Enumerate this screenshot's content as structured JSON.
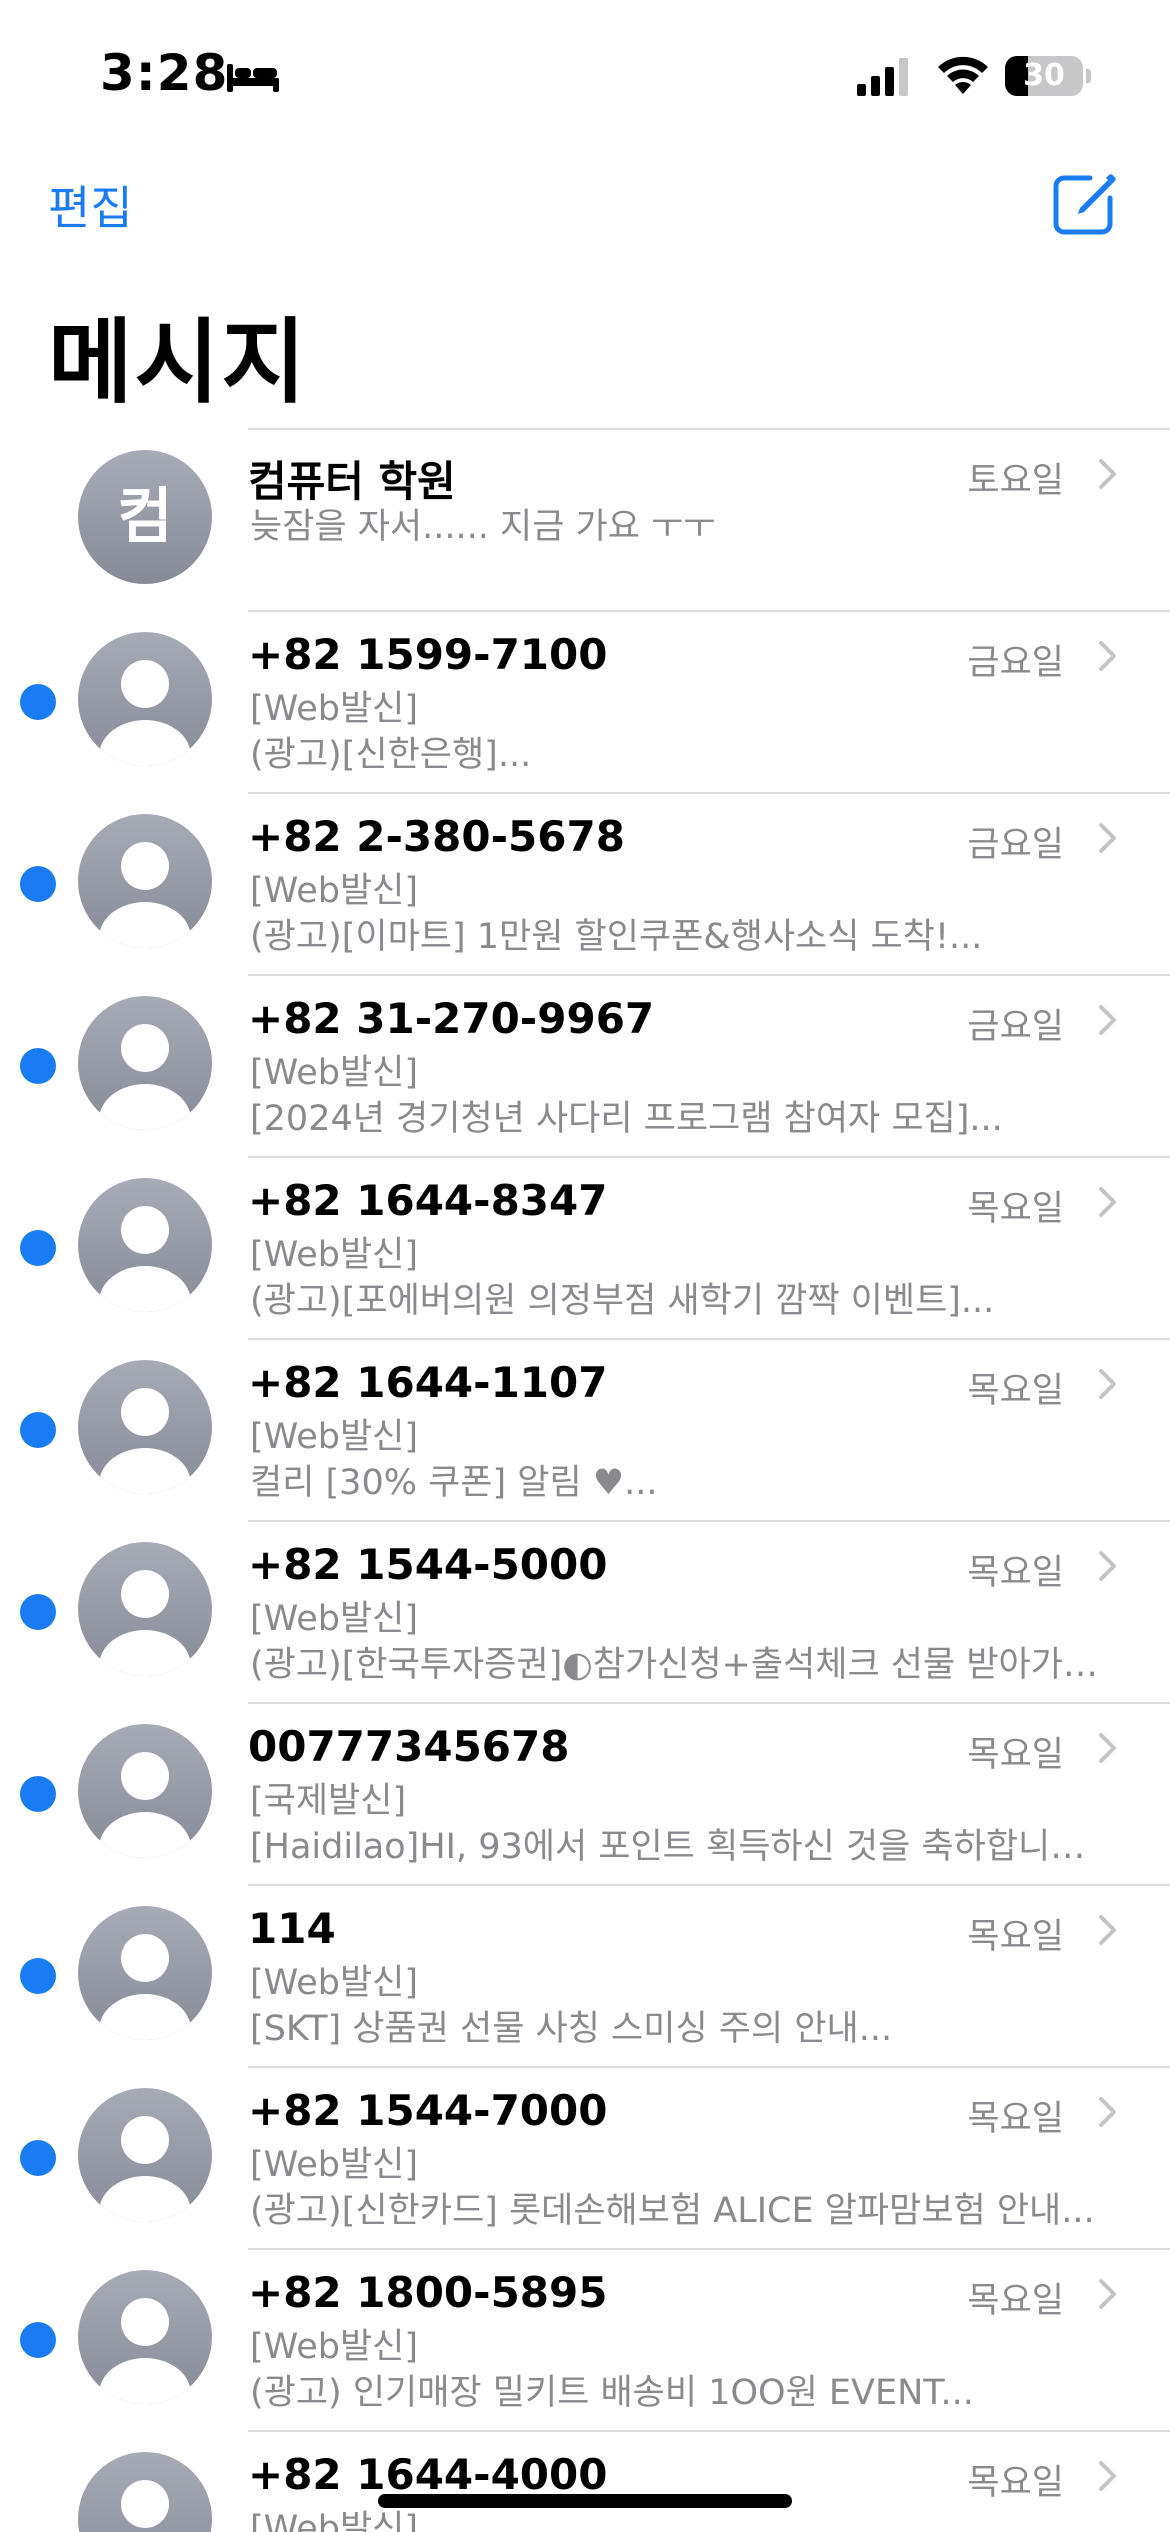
{
  "status_bar": {
    "time": "3:28",
    "battery": "30",
    "battery_level_percent": 30
  },
  "nav": {
    "edit_label": "편집",
    "title": "메시지"
  },
  "conversations": [
    {
      "sender": "컴퓨터 학원",
      "day": "토요일",
      "preview1": "늦잠을 자서...... 지금 가요 ㅜㅜ",
      "preview2": "",
      "unread": false,
      "initial": "컴"
    },
    {
      "sender": "+82 1599-7100",
      "day": "금요일",
      "preview1": "[Web발신]",
      "preview2": "(광고)[신한은행]...",
      "unread": true,
      "initial": ""
    },
    {
      "sender": "+82 2-380-5678",
      "day": "금요일",
      "preview1": "[Web발신]",
      "preview2": "(광고)[이마트] 1만원 할인쿠폰&행사소식 도착!...",
      "unread": true,
      "initial": ""
    },
    {
      "sender": "+82 31-270-9967",
      "day": "금요일",
      "preview1": "[Web발신]",
      "preview2": "[2024년 경기청년 사다리 프로그램 참여자 모집]...",
      "unread": true,
      "initial": ""
    },
    {
      "sender": "+82 1644-8347",
      "day": "목요일",
      "preview1": "[Web발신]",
      "preview2": "(광고)[포에버의원 의정부점 새학기 깜짝 이벤트]...",
      "unread": true,
      "initial": ""
    },
    {
      "sender": "+82 1644-1107",
      "day": "목요일",
      "preview1": "[Web발신]",
      "preview2": "컬리 [30% 쿠폰] 알림 ♥...",
      "unread": true,
      "initial": ""
    },
    {
      "sender": "+82 1544-5000",
      "day": "목요일",
      "preview1": "[Web발신]",
      "preview2": "(광고)[한국투자증권]◐참가신청+출석체크 선물 받아가세…",
      "unread": true,
      "initial": ""
    },
    {
      "sender": "00777345678",
      "day": "목요일",
      "preview1": "[국제발신]",
      "preview2": "[Haidilao]HI, 93에서 포인트 획득하신 것을 축하합니다....",
      "unread": true,
      "initial": ""
    },
    {
      "sender": "114",
      "day": "목요일",
      "preview1": "[Web발신]",
      "preview2": "[SKT] 상품권 선물 사칭 스미싱 주의 안내...",
      "unread": true,
      "initial": ""
    },
    {
      "sender": "+82 1544-7000",
      "day": "목요일",
      "preview1": "[Web발신]",
      "preview2": "(광고)[신한카드] 롯데손해보험 ALICE 알파맘보험 안내...",
      "unread": true,
      "initial": ""
    },
    {
      "sender": "+82 1800-5895",
      "day": "목요일",
      "preview1": "[Web발신]",
      "preview2": "(광고) 인기매장 밀키트 배송비 1OO원 EVENT...",
      "unread": true,
      "initial": ""
    },
    {
      "sender": "+82 1644-4000",
      "day": "목요일",
      "preview1": "[Web발신]",
      "preview2": "",
      "unread": false,
      "initial": ""
    }
  ],
  "colors": {
    "accent": "#1a7cf3",
    "secondary_text": "#8a8a8e",
    "avatar_gray": "#9a9ea9"
  },
  "icons": {
    "status": [
      "bed-icon",
      "cellular-signal-icon",
      "wifi-icon",
      "battery-icon"
    ],
    "compose": "compose-icon",
    "row_chevron": "chevron-right-icon",
    "avatar": "person-silhouette-icon"
  }
}
